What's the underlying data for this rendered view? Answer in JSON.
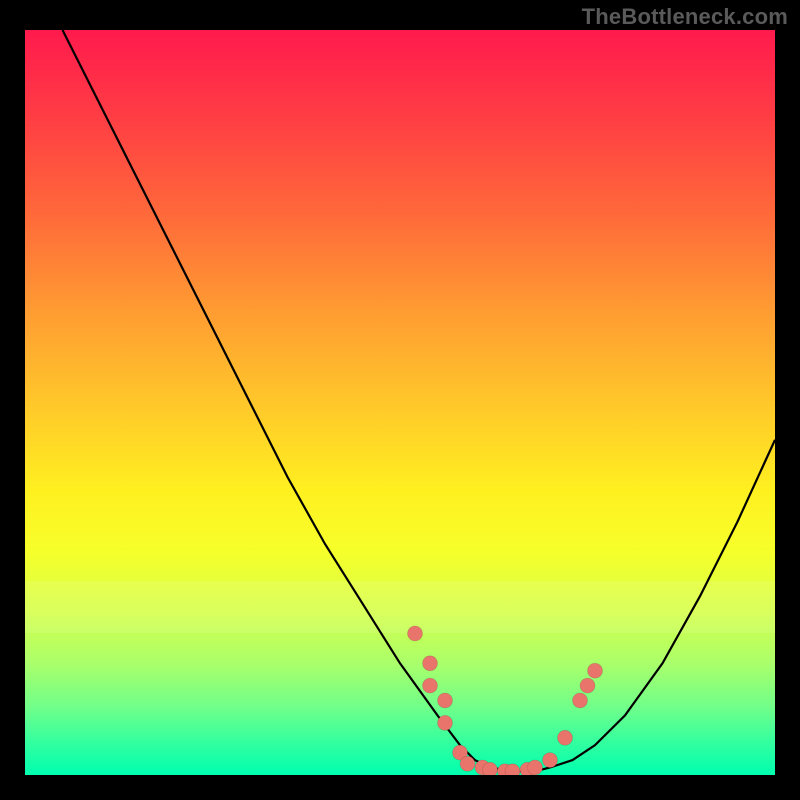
{
  "attribution": "TheBottleneck.com",
  "chart_data": {
    "type": "line",
    "title": "",
    "xlabel": "",
    "ylabel": "",
    "xlim": [
      0,
      100
    ],
    "ylim": [
      0,
      100
    ],
    "grid": false,
    "legend": false,
    "series": [
      {
        "name": "curve",
        "x": [
          5,
          10,
          15,
          20,
          25,
          30,
          35,
          40,
          45,
          50,
          55,
          58,
          60,
          62,
          65,
          68,
          70,
          73,
          76,
          80,
          85,
          90,
          95,
          100
        ],
        "y": [
          100,
          90,
          80,
          70,
          60,
          50,
          40,
          31,
          23,
          15,
          8,
          4,
          2,
          1,
          0.5,
          0.5,
          1,
          2,
          4,
          8,
          15,
          24,
          34,
          45
        ]
      }
    ],
    "points": [
      {
        "x": 52,
        "y": 19
      },
      {
        "x": 54,
        "y": 15
      },
      {
        "x": 54,
        "y": 12
      },
      {
        "x": 56,
        "y": 10
      },
      {
        "x": 56,
        "y": 7
      },
      {
        "x": 58,
        "y": 3
      },
      {
        "x": 59,
        "y": 1.5
      },
      {
        "x": 61,
        "y": 1
      },
      {
        "x": 62,
        "y": 0.7
      },
      {
        "x": 64,
        "y": 0.5
      },
      {
        "x": 65,
        "y": 0.5
      },
      {
        "x": 67,
        "y": 0.7
      },
      {
        "x": 68,
        "y": 1
      },
      {
        "x": 70,
        "y": 2
      },
      {
        "x": 72,
        "y": 5
      },
      {
        "x": 74,
        "y": 10
      },
      {
        "x": 75,
        "y": 12
      },
      {
        "x": 76,
        "y": 14
      }
    ]
  },
  "colors": {
    "background": "#000000",
    "curve": "#000000",
    "dot": "#e8746b",
    "attribution": "#5a5a5a"
  }
}
